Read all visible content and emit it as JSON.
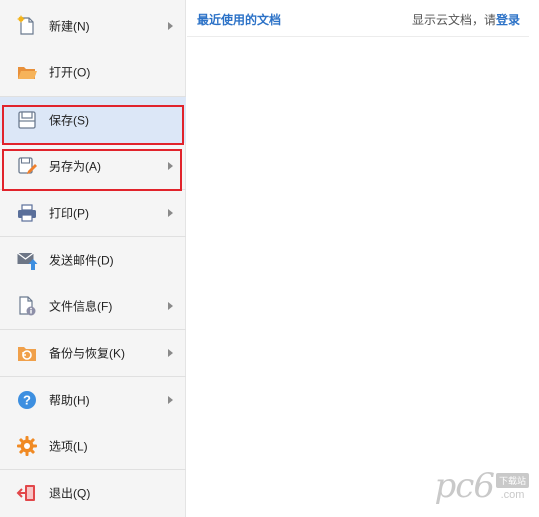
{
  "menu": {
    "items": [
      {
        "label": "新建(N)",
        "icon": "new-file-icon",
        "has_submenu": true
      },
      {
        "label": "打开(O)",
        "icon": "open-folder-icon",
        "has_submenu": false
      },
      {
        "label": "保存(S)",
        "icon": "save-icon",
        "has_submenu": false,
        "selected": true
      },
      {
        "label": "另存为(A)",
        "icon": "save-as-icon",
        "has_submenu": true
      },
      {
        "label": "打印(P)",
        "icon": "printer-icon",
        "has_submenu": true
      },
      {
        "label": "发送邮件(D)",
        "icon": "send-mail-icon",
        "has_submenu": false
      },
      {
        "label": "文件信息(F)",
        "icon": "file-info-icon",
        "has_submenu": true
      },
      {
        "label": "备份与恢复(K)",
        "icon": "backup-restore-icon",
        "has_submenu": true
      },
      {
        "label": "帮助(H)",
        "icon": "help-icon",
        "has_submenu": true
      },
      {
        "label": "选项(L)",
        "icon": "gear-icon",
        "has_submenu": false
      },
      {
        "label": "退出(Q)",
        "icon": "exit-icon",
        "has_submenu": false
      }
    ]
  },
  "panel": {
    "recent_title": "最近使用的文档",
    "cloud_prompt": "显示云文档，请",
    "login_link": "登录"
  },
  "watermark": {
    "text": "pc6",
    "tag": "下载站",
    "domain": ".com"
  },
  "colors": {
    "accent_blue": "#2c72c7",
    "highlight_red": "#e1232b",
    "selected_bg": "#dce7f7"
  }
}
